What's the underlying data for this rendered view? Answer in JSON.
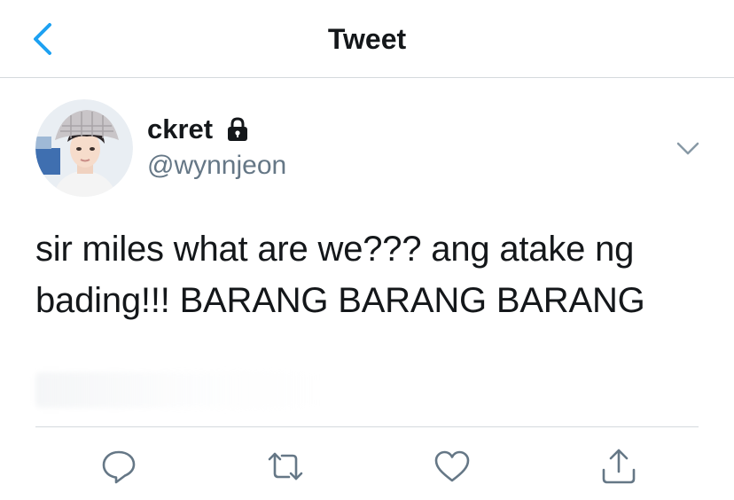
{
  "header": {
    "title": "Tweet",
    "back_icon": "chevron-left-icon",
    "accent_color": "#1da1f2"
  },
  "tweet": {
    "display_name": "ckret",
    "protected_icon": "lock-icon",
    "handle": "@wynnjeon",
    "text": "sir miles what are we??? ang atake ng bading!!! BARANG BARANG BARANG",
    "more_icon": "chevron-down-icon"
  },
  "actions": [
    {
      "name": "reply",
      "icon": "reply-icon"
    },
    {
      "name": "retweet",
      "icon": "retweet-icon"
    },
    {
      "name": "like",
      "icon": "heart-icon"
    },
    {
      "name": "share",
      "icon": "share-icon"
    }
  ],
  "colors": {
    "text_primary": "#14171a",
    "text_secondary": "#657786",
    "icon_gray": "#657786",
    "divider": "#d5d9dd"
  }
}
